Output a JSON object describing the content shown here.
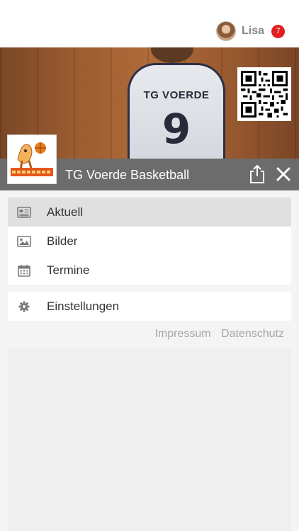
{
  "user": {
    "name": "Lisa",
    "notifications": "7"
  },
  "hero": {
    "jersey_team": "TG VOERDE",
    "jersey_number": "9"
  },
  "club": {
    "name": "TG Voerde Basketball"
  },
  "menu": [
    {
      "label": "Aktuell",
      "icon": "newspaper-icon",
      "active": true
    },
    {
      "label": "Bilder",
      "icon": "image-icon",
      "active": false
    },
    {
      "label": "Termine",
      "icon": "calendar-icon",
      "active": false
    }
  ],
  "settings": {
    "label": "Einstellungen",
    "icon": "gear-icon"
  },
  "footer": {
    "impressum": "Impressum",
    "datenschutz": "Datenschutz"
  },
  "colors": {
    "titlebar": "#6c6c6c",
    "badge": "#e02020",
    "active_item": "#e0e0e0"
  }
}
